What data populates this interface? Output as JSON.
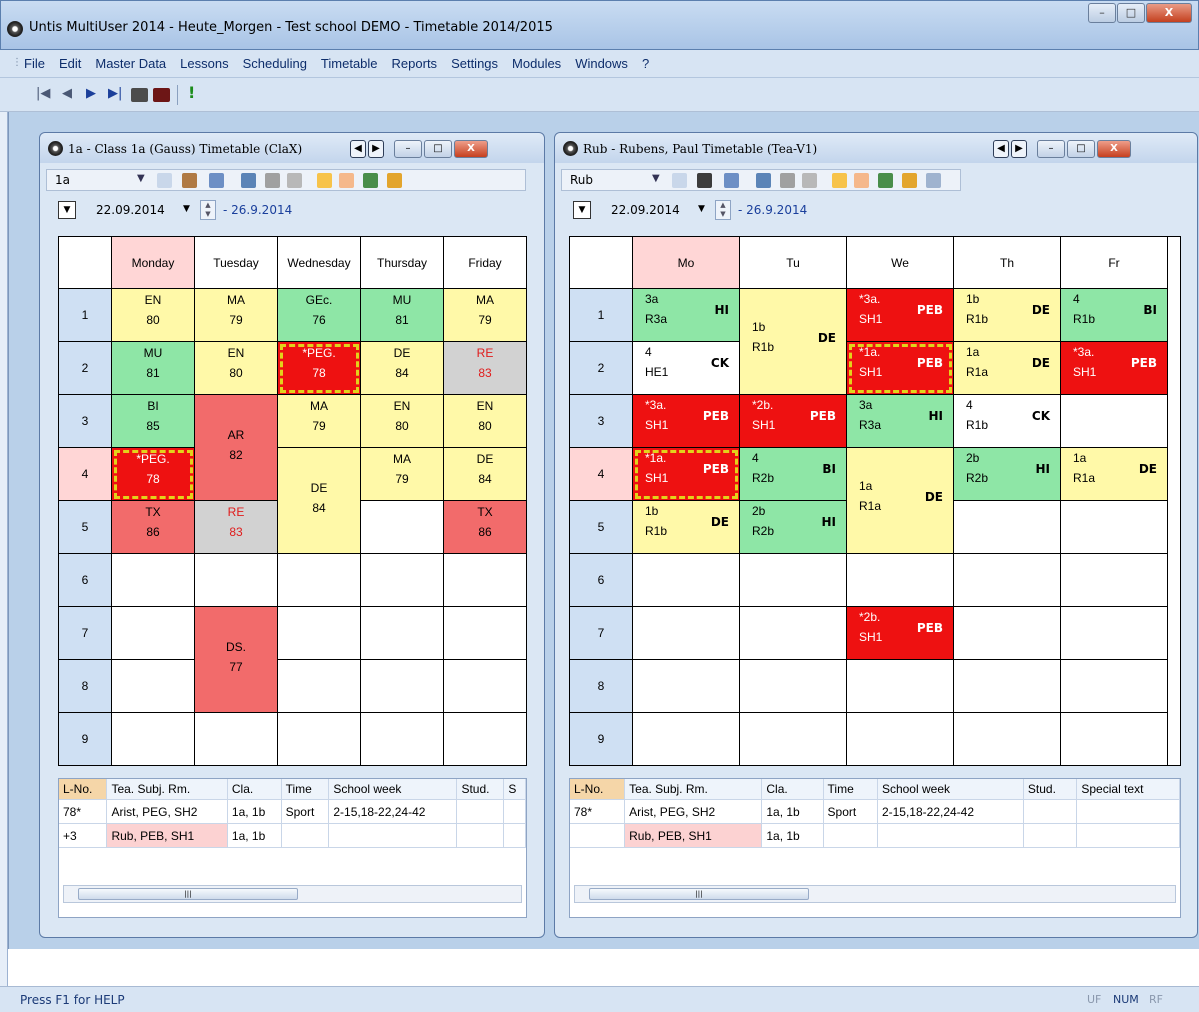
{
  "app": {
    "title": "Untis MultiUser 2014 - Heute_Morgen -  Test school  DEMO  -  Timetable 2014/2015",
    "status_help": "Press F1 for HELP",
    "status": [
      "UF",
      "NUM",
      "RF"
    ]
  },
  "window_buttons": {
    "minimize": "–",
    "maximize": "□",
    "close": "X"
  },
  "menu": [
    "File",
    "Edit",
    "Master Data",
    "Lessons",
    "Scheduling",
    "Timetable",
    "Reports",
    "Settings",
    "Modules",
    "Windows",
    "?"
  ],
  "toolbar_icons": [
    "first-record-icon",
    "prev-record-icon",
    "next-record-icon",
    "last-record-icon",
    "print-icon",
    "print-preview-icon",
    "exclamation-icon"
  ],
  "class_window": {
    "title": "1a - Class 1a (Gauss)  Timetable  (ClaX)",
    "element": "1a",
    "date": "22.09.2014",
    "date_end": "- 26.9.2014",
    "days": [
      "Monday",
      "Tuesday",
      "Wednesday",
      "Thursday",
      "Friday"
    ],
    "periods": [
      "1",
      "2",
      "3",
      "4",
      "5",
      "6",
      "7",
      "8",
      "9"
    ],
    "bottom_headers": [
      "L-No.",
      "Tea. Subj. Rm.",
      "Cla.",
      "Time",
      "School week",
      "Stud.",
      "S"
    ],
    "bottom_rows": [
      [
        "78*",
        "Arist, PEG, SH2",
        "1a, 1b",
        "Sport",
        "2-15,18-22,24-42",
        "",
        ""
      ],
      [
        "+3",
        "Rub, PEB, SH1",
        "1a, 1b",
        "",
        "",
        "",
        ""
      ]
    ],
    "lessons": [
      {
        "day": 1,
        "p": 1,
        "len": 1,
        "l1": "EN",
        "l2": "80",
        "c": "y"
      },
      {
        "day": 2,
        "p": 1,
        "len": 1,
        "l1": "MA",
        "l2": "79",
        "c": "y"
      },
      {
        "day": 3,
        "p": 1,
        "len": 1,
        "l1": "GEc.",
        "l2": "76",
        "c": "g"
      },
      {
        "day": 4,
        "p": 1,
        "len": 1,
        "l1": "MU",
        "l2": "81",
        "c": "g"
      },
      {
        "day": 5,
        "p": 1,
        "len": 1,
        "l1": "MA",
        "l2": "79",
        "c": "y"
      },
      {
        "day": 1,
        "p": 2,
        "len": 1,
        "l1": "MU",
        "l2": "81",
        "c": "g"
      },
      {
        "day": 2,
        "p": 2,
        "len": 1,
        "l1": "EN",
        "l2": "80",
        "c": "y"
      },
      {
        "day": 3,
        "p": 2,
        "len": 1,
        "l1": "*PEG.",
        "l2": "78",
        "c": "r",
        "sel": true
      },
      {
        "day": 4,
        "p": 2,
        "len": 1,
        "l1": "DE",
        "l2": "84",
        "c": "y"
      },
      {
        "day": 5,
        "p": 2,
        "len": 1,
        "l1": "RE",
        "l2": "83",
        "c": "gr",
        "red": true
      },
      {
        "day": 1,
        "p": 3,
        "len": 1,
        "l1": "BI",
        "l2": "85",
        "c": "g"
      },
      {
        "day": 2,
        "p": 3,
        "len": 2,
        "l1": "AR",
        "l2": "82",
        "c": "s"
      },
      {
        "day": 3,
        "p": 3,
        "len": 1,
        "l1": "MA",
        "l2": "79",
        "c": "y"
      },
      {
        "day": 4,
        "p": 3,
        "len": 1,
        "l1": "EN",
        "l2": "80",
        "c": "y"
      },
      {
        "day": 5,
        "p": 3,
        "len": 1,
        "l1": "EN",
        "l2": "80",
        "c": "y"
      },
      {
        "day": 1,
        "p": 4,
        "len": 1,
        "l1": "*PEG.",
        "l2": "78",
        "c": "r",
        "sel": true
      },
      {
        "day": 3,
        "p": 4,
        "len": 2,
        "l1": "DE",
        "l2": "84",
        "c": "y"
      },
      {
        "day": 4,
        "p": 4,
        "len": 1,
        "l1": "MA",
        "l2": "79",
        "c": "y"
      },
      {
        "day": 5,
        "p": 4,
        "len": 1,
        "l1": "DE",
        "l2": "84",
        "c": "y"
      },
      {
        "day": 1,
        "p": 5,
        "len": 1,
        "l1": "TX",
        "l2": "86",
        "c": "s"
      },
      {
        "day": 2,
        "p": 5,
        "len": 1,
        "l1": "RE",
        "l2": "83",
        "c": "gr",
        "red": true
      },
      {
        "day": 5,
        "p": 5,
        "len": 1,
        "l1": "TX",
        "l2": "86",
        "c": "s"
      },
      {
        "day": 2,
        "p": 7,
        "len": 2,
        "l1": "DS.",
        "l2": "77",
        "c": "s"
      }
    ]
  },
  "teacher_window": {
    "title": "Rub - Rubens, Paul  Timetable  (Tea-V1)",
    "element": "Rub",
    "date": "22.09.2014",
    "date_end": "- 26.9.2014",
    "days": [
      "Mo",
      "Tu",
      "We",
      "Th",
      "Fr"
    ],
    "periods": [
      "1",
      "2",
      "3",
      "4",
      "5",
      "6",
      "7",
      "8",
      "9"
    ],
    "bottom_headers": [
      "L-No.",
      "Tea. Subj. Rm.",
      "Cla.",
      "Time",
      "School week",
      "Stud.",
      "Special text"
    ],
    "bottom_rows": [
      [
        "78*",
        "Arist, PEG, SH2",
        "1a, 1b",
        "Sport",
        "2-15,18-22,24-42",
        "",
        ""
      ],
      [
        "",
        "Rub, PEB, SH1",
        "1a, 1b",
        "",
        "",
        "",
        ""
      ]
    ],
    "lessons": [
      {
        "day": 1,
        "p": 1,
        "len": 1,
        "cls": "3a",
        "rm": "R3a",
        "subj": "HI",
        "c": "g"
      },
      {
        "day": 2,
        "p": 1,
        "len": 2,
        "cls": "1b",
        "rm": "R1b",
        "subj": "DE",
        "c": "y"
      },
      {
        "day": 3,
        "p": 1,
        "len": 1,
        "cls": "*3a.",
        "rm": "SH1",
        "subj": "PEB",
        "c": "r"
      },
      {
        "day": 4,
        "p": 1,
        "len": 1,
        "cls": "1b",
        "rm": "R1b",
        "subj": "DE",
        "c": "y"
      },
      {
        "day": 5,
        "p": 1,
        "len": 1,
        "cls": "4",
        "rm": "R1b",
        "subj": "BI",
        "c": "g"
      },
      {
        "day": 1,
        "p": 2,
        "len": 1,
        "cls": "4",
        "rm": "HE1",
        "subj": "CK",
        "c": "w"
      },
      {
        "day": 3,
        "p": 2,
        "len": 1,
        "cls": "*1a.",
        "rm": "SH1",
        "subj": "PEB",
        "c": "r",
        "sel": true
      },
      {
        "day": 4,
        "p": 2,
        "len": 1,
        "cls": "1a",
        "rm": "R1a",
        "subj": "DE",
        "c": "y"
      },
      {
        "day": 5,
        "p": 2,
        "len": 1,
        "cls": "*3a.",
        "rm": "SH1",
        "subj": "PEB",
        "c": "r"
      },
      {
        "day": 1,
        "p": 3,
        "len": 1,
        "cls": "*3a.",
        "rm": "SH1",
        "subj": "PEB",
        "c": "r"
      },
      {
        "day": 2,
        "p": 3,
        "len": 1,
        "cls": "*2b.",
        "rm": "SH1",
        "subj": "PEB",
        "c": "r"
      },
      {
        "day": 3,
        "p": 3,
        "len": 1,
        "cls": "3a",
        "rm": "R3a",
        "subj": "HI",
        "c": "g"
      },
      {
        "day": 4,
        "p": 3,
        "len": 1,
        "cls": "4",
        "rm": "R1b",
        "subj": "CK",
        "c": "w"
      },
      {
        "day": 1,
        "p": 4,
        "len": 1,
        "cls": "*1a.",
        "rm": "SH1",
        "subj": "PEB",
        "c": "r",
        "sel": true
      },
      {
        "day": 2,
        "p": 4,
        "len": 1,
        "cls": "4",
        "rm": "R2b",
        "subj": "BI",
        "c": "g"
      },
      {
        "day": 3,
        "p": 4,
        "len": 2,
        "cls": "1a",
        "rm": "R1a",
        "subj": "DE",
        "c": "y"
      },
      {
        "day": 4,
        "p": 4,
        "len": 1,
        "cls": "2b",
        "rm": "R2b",
        "subj": "HI",
        "c": "g"
      },
      {
        "day": 5,
        "p": 4,
        "len": 1,
        "cls": "1a",
        "rm": "R1a",
        "subj": "DE",
        "c": "y"
      },
      {
        "day": 1,
        "p": 5,
        "len": 1,
        "cls": "1b",
        "rm": "R1b",
        "subj": "DE",
        "c": "y"
      },
      {
        "day": 2,
        "p": 5,
        "len": 1,
        "cls": "2b",
        "rm": "R2b",
        "subj": "HI",
        "c": "g"
      },
      {
        "day": 3,
        "p": 7,
        "len": 1,
        "cls": "*2b.",
        "rm": "SH1",
        "subj": "PEB",
        "c": "r"
      }
    ]
  }
}
